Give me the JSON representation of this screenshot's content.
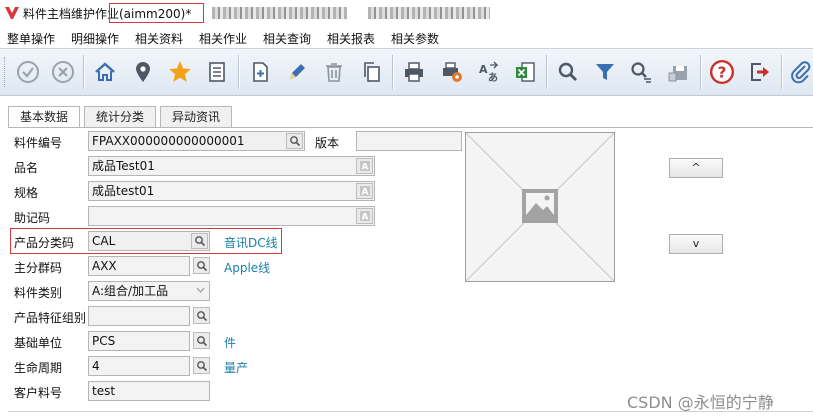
{
  "window": {
    "title": "料件主档维护作业(aimm200)*"
  },
  "menu": [
    {
      "id": "whole",
      "label": "整单操作"
    },
    {
      "id": "detail",
      "label": "明细操作"
    },
    {
      "id": "data",
      "label": "相关资料"
    },
    {
      "id": "ops",
      "label": "相关作业"
    },
    {
      "id": "query",
      "label": "相关查询"
    },
    {
      "id": "report",
      "label": "相关报表"
    },
    {
      "id": "params",
      "label": "相关参数"
    }
  ],
  "tabs": [
    {
      "label": "基本数据",
      "active": true
    },
    {
      "label": "统计分类",
      "active": false
    },
    {
      "label": "异动资讯",
      "active": false
    }
  ],
  "form": {
    "item_no": {
      "label": "料件编号",
      "value": "FPAXX000000000000001"
    },
    "version": {
      "label": "版本",
      "value": ""
    },
    "name": {
      "label": "品名",
      "value": "成品Test01"
    },
    "spec": {
      "label": "规格",
      "value": "成品test01"
    },
    "mnemonic": {
      "label": "助记码",
      "value": ""
    },
    "category": {
      "label": "产品分类码",
      "value": "CAL",
      "desc": "音讯DC线"
    },
    "group": {
      "label": "主分群码",
      "value": "AXX",
      "desc": "Apple线"
    },
    "type": {
      "label": "料件类别",
      "value": "A:组合/加工品"
    },
    "feature": {
      "label": "产品特征组别",
      "value": ""
    },
    "unit": {
      "label": "基础单位",
      "value": "PCS",
      "desc": "件"
    },
    "lifecycle": {
      "label": "生命周期",
      "value": "4",
      "desc": "量产"
    },
    "customer": {
      "label": "客户料号",
      "value": "test"
    }
  },
  "nav": {
    "up": "^",
    "down": "v"
  },
  "watermark": "CSDN @永恒的宁静",
  "colors": {
    "highlight": "#d9383a",
    "link": "#1a7fa8",
    "star": "#f5a21b",
    "toolbar_icon": "#3a6fb0"
  }
}
